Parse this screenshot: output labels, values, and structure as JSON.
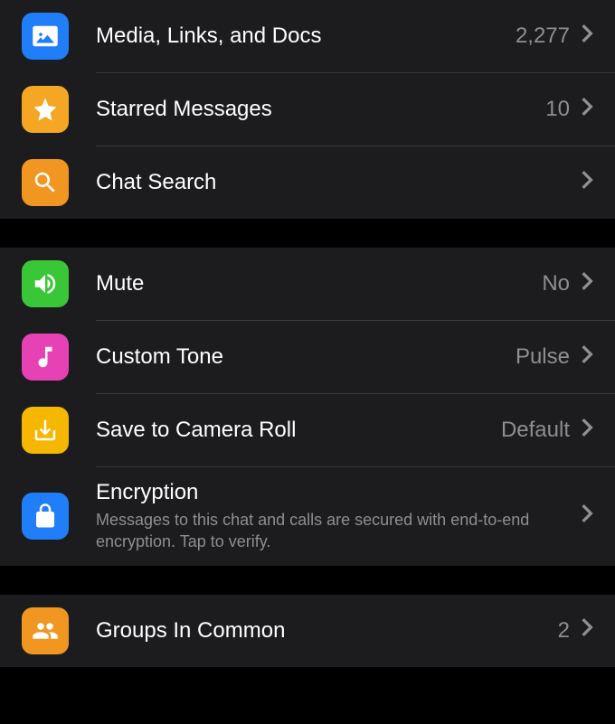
{
  "section1": {
    "media": {
      "label": "Media, Links, and Docs",
      "value": "2,277"
    },
    "starred": {
      "label": "Starred Messages",
      "value": "10"
    },
    "search": {
      "label": "Chat Search"
    }
  },
  "section2": {
    "mute": {
      "label": "Mute",
      "value": "No"
    },
    "tone": {
      "label": "Custom Tone",
      "value": "Pulse"
    },
    "camera": {
      "label": "Save to Camera Roll",
      "value": "Default"
    },
    "encryption": {
      "label": "Encryption",
      "subtitle": "Messages to this chat and calls are secured with end-to-end encryption. Tap to verify."
    }
  },
  "section3": {
    "groups": {
      "label": "Groups In Common",
      "value": "2"
    }
  }
}
